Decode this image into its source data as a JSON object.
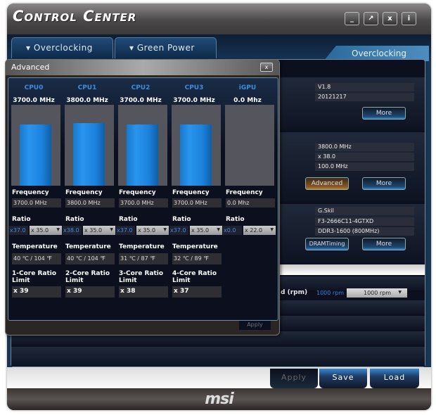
{
  "window": {
    "title": "Control Center",
    "buttons": [
      "_",
      "↗",
      "x",
      "i"
    ]
  },
  "tabs": [
    {
      "label": "Overclocking"
    },
    {
      "label": "Green Power"
    }
  ],
  "active_section": "Overclocking",
  "right_panel": {
    "bios": {
      "version": "V1.8",
      "date": "20121217",
      "more_label": "More"
    },
    "cpu": {
      "frequency": "3800.0 MHz",
      "ratio": "x 38.0",
      "base_clock": "100.0 MHz",
      "advanced_label": "Advanced",
      "more_label": "More"
    },
    "memory": {
      "vendor": "G.Skil",
      "part": "F3-2666C11-4GTXD",
      "type": "DDR3-1600 (800MHz)",
      "dram_timing_label": "DRAMTiming",
      "more_label": "More"
    },
    "fan": {
      "label_fragment": "d (rpm)",
      "current": "1000 rpm",
      "selected": "1000 rpm"
    }
  },
  "footer_buttons": {
    "apply": "Apply",
    "save": "Save",
    "load": "Load"
  },
  "brand": "msi",
  "advanced": {
    "title": "Advanced",
    "close": "x",
    "apply_label": "Apply",
    "labels": {
      "frequency": "Frequency",
      "ratio": "Ratio",
      "temperature": "Temperature"
    },
    "cores": [
      {
        "name": "CPU0",
        "mhz_label": "3700.0 MHz",
        "mhz": 3700,
        "frequency": "3700.0 MHz",
        "ratio_current": "x37.0",
        "ratio_select": "x 35.0",
        "temperature": "40 ℃ / 104 ℉",
        "limit_label": "1-Core Ratio Limit",
        "limit": "x 39"
      },
      {
        "name": "CPU1",
        "mhz_label": "3800.0 MHz",
        "mhz": 3800,
        "frequency": "3800.0 MHz",
        "ratio_current": "x38.0",
        "ratio_select": "x 35.0",
        "temperature": "40 ℃ / 104 ℉",
        "limit_label": "2-Core Ratio Limit",
        "limit": "x 39"
      },
      {
        "name": "CPU2",
        "mhz_label": "3700.0 MHz",
        "mhz": 3700,
        "frequency": "3700.0 MHz",
        "ratio_current": "x37.0",
        "ratio_select": "x 35.0",
        "temperature": "31 ℃ / 87 ℉",
        "limit_label": "3-Core Ratio Limit",
        "limit": "x 38"
      },
      {
        "name": "CPU3",
        "mhz_label": "3700.0 MHz",
        "mhz": 3700,
        "frequency": "3700.0 MHz",
        "ratio_current": "x37.0",
        "ratio_select": "x 35.0",
        "temperature": "32 ℃ / 89 ℉",
        "limit_label": "4-Core Ratio Limit",
        "limit": "x 37"
      },
      {
        "name": "iGPU",
        "mhz_label": "0.0 Mhz",
        "mhz": 0,
        "frequency": "0.0 Mhz",
        "ratio_current": "x0.0",
        "ratio_select": "x 22.0"
      }
    ]
  },
  "colors": {
    "accent_blue": "#2a95ee",
    "panel": "#0b0f1e",
    "advanced_button": "#8a5a20"
  }
}
